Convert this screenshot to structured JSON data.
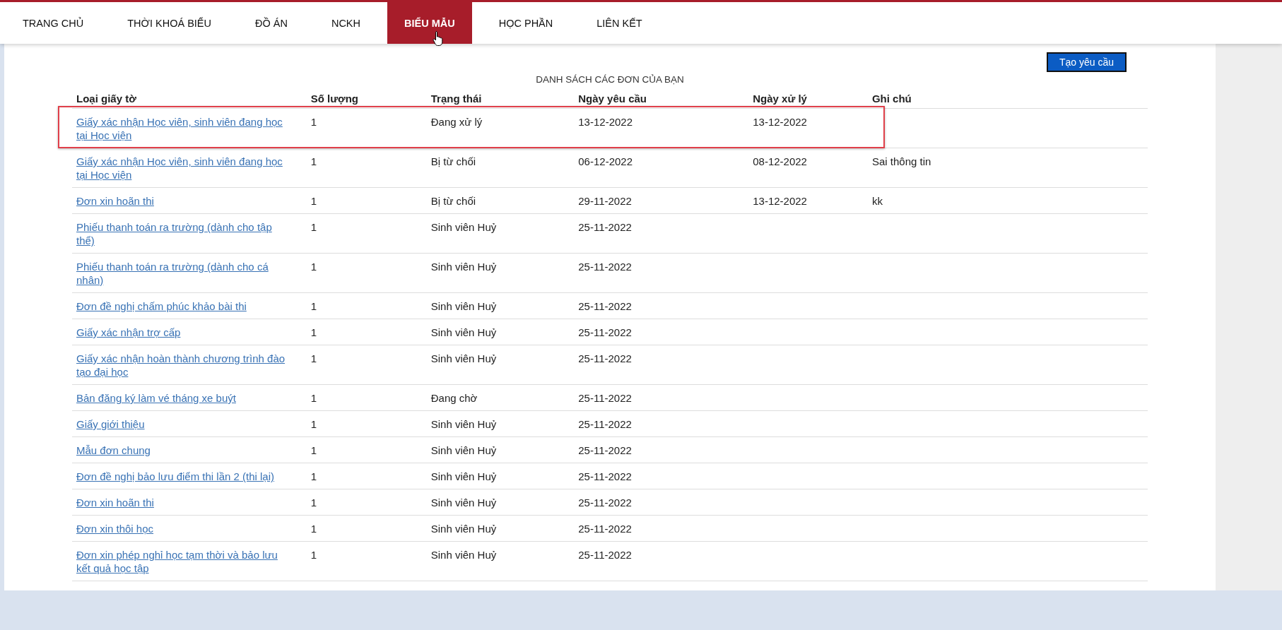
{
  "nav": {
    "tabs": [
      {
        "label": "TRANG CHỦ",
        "selected": false
      },
      {
        "label": "THỜI KHOÁ BIỂU",
        "selected": false
      },
      {
        "label": "ĐỒ ÁN",
        "selected": false
      },
      {
        "label": "NCKH",
        "selected": false
      },
      {
        "label": "BIỂU MẪU",
        "selected": true
      },
      {
        "label": "HỌC PHẦN",
        "selected": false
      },
      {
        "label": "LIÊN KẾT",
        "selected": false
      }
    ]
  },
  "create_button": "Tạo yêu cầu",
  "table": {
    "title": "DANH SÁCH CÁC ĐƠN CỦA BẠN",
    "columns": [
      "Loại giấy tờ",
      "Số lượng",
      "Trạng thái",
      "Ngày yêu cầu",
      "Ngày xử lý",
      "Ghi chú"
    ],
    "rows": [
      {
        "highlighted": true,
        "cells": [
          "Giấy xác nhận Học viên, sinh viên đang học tại Học viện",
          "1",
          "Đang xử lý",
          "13-12-2022",
          "13-12-2022",
          ""
        ]
      },
      {
        "highlighted": false,
        "cells": [
          "Giấy xác nhận Học viên, sinh viên đang học tại Học viện",
          "1",
          "Bị từ chối",
          "06-12-2022",
          "08-12-2022",
          "Sai thông tin"
        ]
      },
      {
        "highlighted": false,
        "cells": [
          "Đơn xin hoãn thi",
          "1",
          "Bị từ chối",
          "29-11-2022",
          "13-12-2022",
          "kk"
        ]
      },
      {
        "highlighted": false,
        "cells": [
          "Phiếu thanh toán ra trường (dành cho tập thể)",
          "1",
          "Sinh viên Huỷ",
          "25-11-2022",
          "",
          ""
        ]
      },
      {
        "highlighted": false,
        "cells": [
          "Phiếu thanh toán ra trường (dành cho cá nhân)",
          "1",
          "Sinh viên Huỷ",
          "25-11-2022",
          "",
          ""
        ]
      },
      {
        "highlighted": false,
        "cells": [
          "Đơn đề nghị chấm phúc khảo bài thi",
          "1",
          "Sinh viên Huỷ",
          "25-11-2022",
          "",
          ""
        ]
      },
      {
        "highlighted": false,
        "cells": [
          "Giấy xác nhận trợ cấp",
          "1",
          "Sinh viên Huỷ",
          "25-11-2022",
          "",
          ""
        ]
      },
      {
        "highlighted": false,
        "cells": [
          "Giấy xác nhận hoàn thành chương trình đào tạo đại học",
          "1",
          "Sinh viên Huỷ",
          "25-11-2022",
          "",
          ""
        ]
      },
      {
        "highlighted": false,
        "cells": [
          "Bản đăng ký làm vé tháng xe buýt",
          "1",
          "Đang chờ",
          "25-11-2022",
          "",
          ""
        ]
      },
      {
        "highlighted": false,
        "cells": [
          "Giấy giới thiệu",
          "1",
          "Sinh viên Huỷ",
          "25-11-2022",
          "",
          ""
        ]
      },
      {
        "highlighted": false,
        "cells": [
          "Mẫu đơn chung",
          "1",
          "Sinh viên Huỷ",
          "25-11-2022",
          "",
          ""
        ]
      },
      {
        "highlighted": false,
        "cells": [
          "Đơn đề nghị bảo lưu điểm thi lần 2 (thi lại)",
          "1",
          "Sinh viên Huỷ",
          "25-11-2022",
          "",
          ""
        ]
      },
      {
        "highlighted": false,
        "cells": [
          "Đơn xin hoãn thi",
          "1",
          "Sinh viên Huỷ",
          "25-11-2022",
          "",
          ""
        ]
      },
      {
        "highlighted": false,
        "cells": [
          "Đơn xin thôi học",
          "1",
          "Sinh viên Huỷ",
          "25-11-2022",
          "",
          ""
        ]
      },
      {
        "highlighted": false,
        "cells": [
          "Đơn xin phép nghỉ học tạm thời và bảo lưu kết quả học tập",
          "1",
          "Sinh viên Huỷ",
          "25-11-2022",
          "",
          ""
        ]
      }
    ]
  }
}
